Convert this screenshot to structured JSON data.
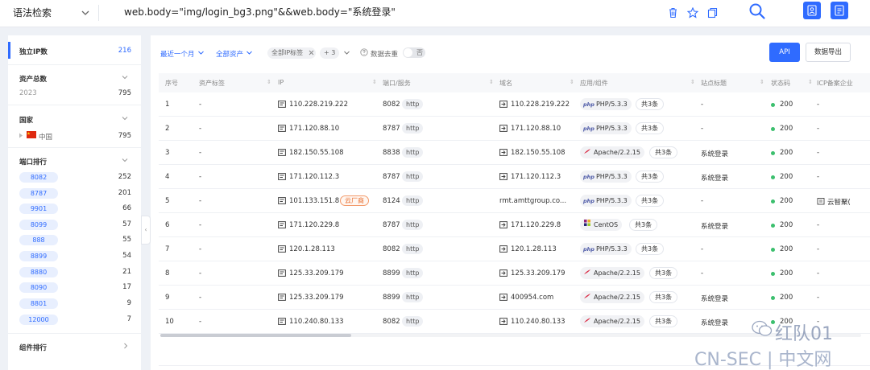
{
  "topbar": {
    "syntax_mode": "语法检索",
    "query": "web.body=\"img/login_bg3.png\"&&web.body=\"系统登录\"",
    "icons": [
      "delete-icon",
      "star-icon",
      "copy-icon",
      "search-icon",
      "profile-icon",
      "document-icon"
    ]
  },
  "sidebar": {
    "unique_ip": {
      "label": "独立IP数",
      "value": "216"
    },
    "total_assets": {
      "label": "资产总数",
      "year": "2023",
      "value": "795"
    },
    "country": {
      "label": "国家",
      "item": "中国",
      "value": "795"
    },
    "port_rank": {
      "label": "端口排行",
      "items": [
        {
          "port": "8082",
          "count": "252"
        },
        {
          "port": "8787",
          "count": "201"
        },
        {
          "port": "9901",
          "count": "66"
        },
        {
          "port": "8099",
          "count": "57"
        },
        {
          "port": "888",
          "count": "55"
        },
        {
          "port": "8899",
          "count": "54"
        },
        {
          "port": "8880",
          "count": "21"
        },
        {
          "port": "8090",
          "count": "17"
        },
        {
          "port": "8801",
          "count": "9"
        },
        {
          "port": "12000",
          "count": "7"
        }
      ]
    },
    "component_rank": {
      "label": "组件排行"
    }
  },
  "filters": {
    "time": "最近一个月",
    "assets": "全部资产",
    "ip_tag": "全部IP标签",
    "extra_count": "+ 3",
    "dedupe_label": "数据去重",
    "dedupe_value": "否"
  },
  "buttons": {
    "api": "API",
    "export": "数据导出"
  },
  "table": {
    "headers": [
      "序号",
      "资产标签",
      "IP",
      "端口/服务",
      "域名",
      "应用/组件",
      "站点标题",
      "状态码",
      "ICP备案企业"
    ],
    "rows": [
      {
        "no": "1",
        "tag": "-",
        "ip": "110.228.219.222",
        "cloud": "",
        "port": "8082",
        "service": "http",
        "domain": "110.228.219.222",
        "app_icon": "php",
        "app": "PHP/5.3.3",
        "more": "共3条",
        "title": "-",
        "status": "200",
        "icp": "-"
      },
      {
        "no": "2",
        "tag": "-",
        "ip": "171.120.88.10",
        "cloud": "",
        "port": "8787",
        "service": "http",
        "domain": "171.120.88.10",
        "app_icon": "php",
        "app": "PHP/5.3.3",
        "more": "共3条",
        "title": "-",
        "status": "200",
        "icp": "-"
      },
      {
        "no": "3",
        "tag": "-",
        "ip": "182.150.55.108",
        "cloud": "",
        "port": "8838",
        "service": "http",
        "domain": "182.150.55.108",
        "app_icon": "apache",
        "app": "Apache/2.2.15",
        "more": "共3条",
        "title": "系统登录",
        "status": "200",
        "icp": "-"
      },
      {
        "no": "4",
        "tag": "-",
        "ip": "171.120.112.3",
        "cloud": "",
        "port": "8787",
        "service": "http",
        "domain": "171.120.112.3",
        "app_icon": "php",
        "app": "PHP/5.3.3",
        "more": "共3条",
        "title": "系统登录",
        "status": "200",
        "icp": "-"
      },
      {
        "no": "5",
        "tag": "-",
        "ip": "101.133.151.8",
        "cloud": "云厂商",
        "port": "8124",
        "service": "http",
        "domain": "rmt.amttgroup.co...",
        "app_icon": "php",
        "app": "PHP/5.3.3",
        "more": "共3条",
        "title": "-",
        "status": "200",
        "icp": "云智聚("
      },
      {
        "no": "6",
        "tag": "-",
        "ip": "171.120.229.8",
        "cloud": "",
        "port": "8787",
        "service": "http",
        "domain": "171.120.229.8",
        "app_icon": "centos",
        "app": "CentOS",
        "more": "共3条",
        "title": "系统登录",
        "status": "200",
        "icp": "-"
      },
      {
        "no": "7",
        "tag": "-",
        "ip": "120.1.28.113",
        "cloud": "",
        "port": "8082",
        "service": "http",
        "domain": "120.1.28.113",
        "app_icon": "php",
        "app": "PHP/5.3.3",
        "more": "共3条",
        "title": "-",
        "status": "200",
        "icp": "-"
      },
      {
        "no": "8",
        "tag": "-",
        "ip": "125.33.209.179",
        "cloud": "",
        "port": "8899",
        "service": "http",
        "domain": "125.33.209.179",
        "app_icon": "apache",
        "app": "Apache/2.2.15",
        "more": "共3条",
        "title": "-",
        "status": "200",
        "icp": "-"
      },
      {
        "no": "9",
        "tag": "-",
        "ip": "125.33.209.179",
        "cloud": "",
        "port": "8899",
        "service": "http",
        "domain": "400954.com",
        "app_icon": "apache",
        "app": "Apache/2.2.15",
        "more": "共3条",
        "title": "系统登录",
        "status": "200",
        "icp": "-"
      },
      {
        "no": "10",
        "tag": "-",
        "ip": "110.240.80.133",
        "cloud": "",
        "port": "8082",
        "service": "http",
        "domain": "110.240.80.133",
        "app_icon": "apache",
        "app": "Apache/2.2.15",
        "more": "共3条",
        "title": "系统登录",
        "status": "200",
        "icp": "-"
      }
    ]
  },
  "watermark": {
    "top": "红队01",
    "bottom": "CN-SEC | 中文网"
  },
  "colors": {
    "accent": "#2f6bff",
    "status_ok": "#3cbf6e",
    "cloud_tag": "#e86c2d"
  }
}
